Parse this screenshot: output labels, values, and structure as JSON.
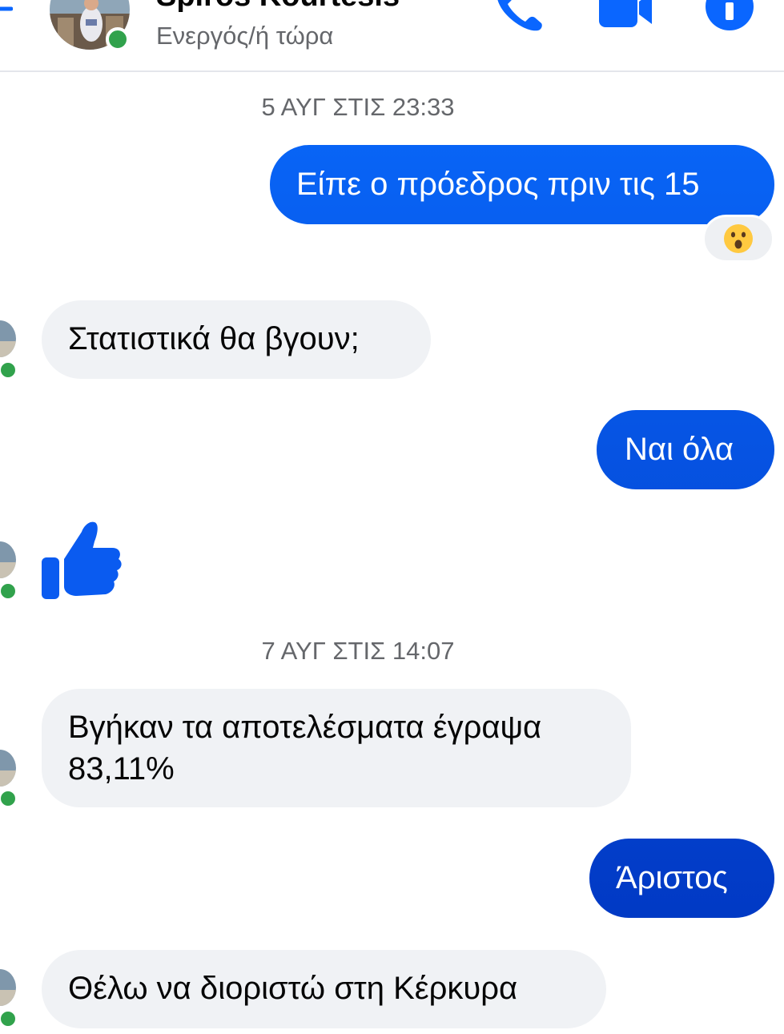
{
  "header": {
    "contact_name": "Spiros Kourtesis",
    "status": "Ενεργός/ή τώρα",
    "icons": [
      "back-arrow-icon",
      "phone-icon",
      "video-camera-icon",
      "info-icon"
    ]
  },
  "conversation": {
    "timestamp_1": "5 ΑΥΓ ΣΤΙΣ 23:33",
    "timestamp_2": "7 ΑΥΓ ΣΤΙΣ 14:07",
    "messages": [
      {
        "direction": "outgoing",
        "text": "Είπε ο πρόεδρος πριν τις 15",
        "reaction": "😮"
      },
      {
        "direction": "incoming",
        "text": "Στατιστικά θα βγουν;"
      },
      {
        "direction": "outgoing",
        "text": "Ναι όλα"
      },
      {
        "direction": "incoming",
        "type": "like",
        "icon": "thumbs-up-icon"
      },
      {
        "direction": "incoming",
        "line1": "Βγήκαν τα αποτελέσματα έγραψα",
        "line2": "83,11%"
      },
      {
        "direction": "outgoing",
        "text": "Άριστος"
      },
      {
        "direction": "incoming",
        "text": "Θέλω να διοριστώ στη Κέρκυρα"
      }
    ]
  },
  "colors": {
    "outgoing_gradient_top": "#0866ff",
    "outgoing_gradient_bottom": "#0036c2",
    "incoming_bubble": "#f0f2f5",
    "accent": "#0a66ff",
    "presence": "#31a24c",
    "secondary_text": "#65676b"
  }
}
